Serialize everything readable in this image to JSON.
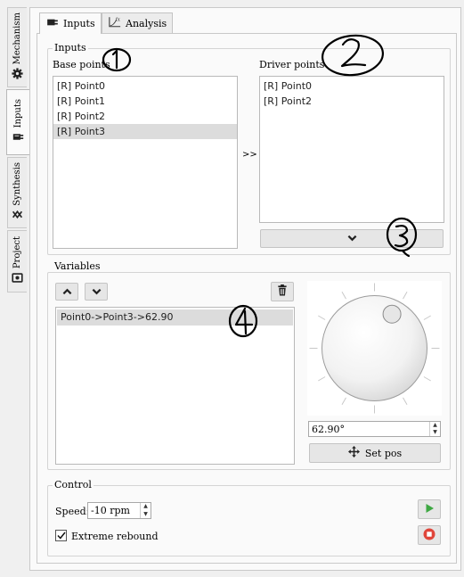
{
  "side_tabs": [
    {
      "label": "Mechanism",
      "icon": "gear-icon"
    },
    {
      "label": "Inputs",
      "icon": "inputs-icon"
    },
    {
      "label": "Synthesis",
      "icon": "synthesis-icon"
    },
    {
      "label": "Project",
      "icon": "project-icon"
    }
  ],
  "top_tabs": [
    {
      "label": "Inputs",
      "icon": "inputs-icon"
    },
    {
      "label": "Analysis",
      "icon": "analysis-chart-icon"
    }
  ],
  "inputs_group": {
    "title": "Inputs",
    "base_label": "Base points",
    "driver_label": "Driver points",
    "base_points": [
      "[R] Point0",
      "[R] Point1",
      "[R] Point2",
      "[R] Point3"
    ],
    "base_selected_index": 3,
    "driver_points": [
      "[R] Point0",
      "[R] Point2"
    ],
    "add_button": ">>",
    "down_icon": "chevron-down-icon"
  },
  "variables_group": {
    "title": "Variables",
    "items": [
      "Point0->Point3->62.90"
    ],
    "selected_index": 0,
    "move_up_icon": "chevron-up-icon",
    "move_down_icon": "chevron-down-icon",
    "delete_icon": "trash-icon",
    "dial_angle_deg": 62.9,
    "angle_value": "62.90°",
    "set_pos_label": "Set pos",
    "set_pos_icon": "move-arrows-icon"
  },
  "control_group": {
    "title": "Control",
    "speed_label": "Speed:",
    "speed_value": "-10 rpm",
    "extreme_rebound_label": "Extreme rebound",
    "extreme_rebound_checked": true,
    "play_icon": "play-icon",
    "stop_icon": "stop-icon",
    "play_color": "#3ea843",
    "stop_color": "#e0453a"
  },
  "annotations": [
    "1",
    "2",
    "3",
    "4"
  ]
}
